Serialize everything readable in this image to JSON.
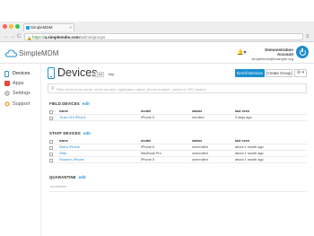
{
  "browser": {
    "tab_title": "SimpleMDM",
    "tab_close": "×",
    "url_scheme": "https://",
    "url_host": "a.simplemdm.com",
    "url_path": "/admin/groups",
    "nav_back": "←",
    "nav_forward": "→",
    "nav_reload": "C",
    "menu_icon": "≡",
    "dot_colors": [
      "#fc605c",
      "#fdbc40",
      "#34c84a"
    ]
  },
  "header": {
    "logo_text": "SimpleMDM",
    "bell_icon": "🔔▾",
    "account_name": "Demonstration Account",
    "account_email": "simplemdm@example.org"
  },
  "sidebar": {
    "items": [
      {
        "label": "Devices",
        "icon": "phone-icon",
        "active": true
      },
      {
        "label": "Apps",
        "icon": "apps-icon",
        "active": false
      },
      {
        "label": "Settings",
        "icon": "gear-icon",
        "active": false
      },
      {
        "label": "Support",
        "icon": "lifebuoy-icon",
        "active": false
      }
    ]
  },
  "main": {
    "title": "Devices",
    "count_badge": "List",
    "map_label": "Map",
    "enroll_button": "Enroll Devices",
    "create_group_button": "Create Group",
    "gear_button": "⚙ ▾",
    "filter_placeholder": "Filter devices by name, serial number, application name, phone number, carrier or IOS version",
    "columns": [
      "name",
      "model",
      "status",
      "last seen"
    ],
    "sections": [
      {
        "title": "FIELD DEVICES",
        "edit": "edit",
        "rows": [
          {
            "name": "Truck 015 iPhone",
            "model": "iPhone 5",
            "status": "enrolled",
            "last_seen": "3 days ago"
          }
        ]
      },
      {
        "title": "STAFF DEVICES",
        "edit": "edit",
        "rows": [
          {
            "name": "Nick's iPhone",
            "model": "iPhone 6",
            "status": "unenrolled",
            "last_seen": "about 1 month ago"
          },
          {
            "name": "Olds",
            "model": "MacBook Pro",
            "status": "unenrolled",
            "last_seen": "about 1 month ago"
          },
          {
            "name": "Sharon's iPhone",
            "model": "iPhone 5",
            "status": "unenrolled",
            "last_seen": "about 1 month ago"
          }
        ]
      },
      {
        "title": "QUARANTINE",
        "edit": "edit",
        "placeholder": "no devices",
        "rows": []
      }
    ]
  },
  "colors": {
    "accent": "#1b8ed0",
    "app_icon_apps": "#e4473b",
    "app_icon_support": "#f0a030"
  }
}
